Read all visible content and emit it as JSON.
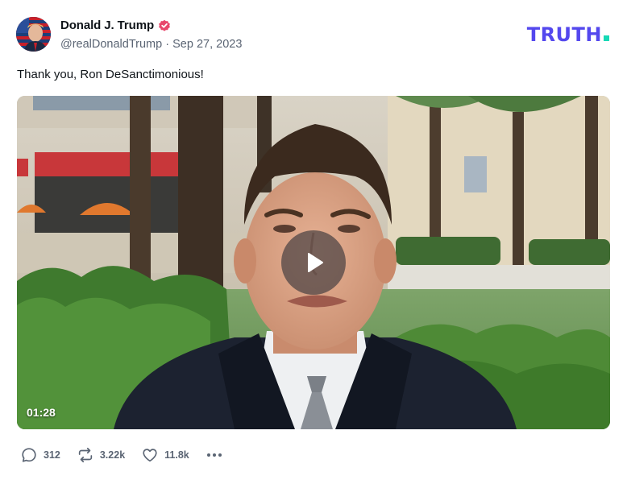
{
  "post": {
    "author": {
      "display_name": "Donald J. Trump",
      "handle": "@realDonaldTrump",
      "verified": true,
      "avatar_icon": "avatar-portrait-flag"
    },
    "separator": "·",
    "date": "Sep 27, 2023",
    "text": "Thank you, Ron DeSanctimonious!",
    "video": {
      "duration": "01:28",
      "play_icon": "play-icon"
    },
    "actions": {
      "replies": "312",
      "retruths": "3.22k",
      "likes": "11.8k",
      "more_icon": "more-horizontal-icon"
    }
  },
  "brand": {
    "logo_text": "TRUTH",
    "logo_color": "#5448ee",
    "logo_dot_color": "#16d9b6"
  },
  "colors": {
    "verified_badge": "#e8476b",
    "muted_text": "#5a6473"
  }
}
